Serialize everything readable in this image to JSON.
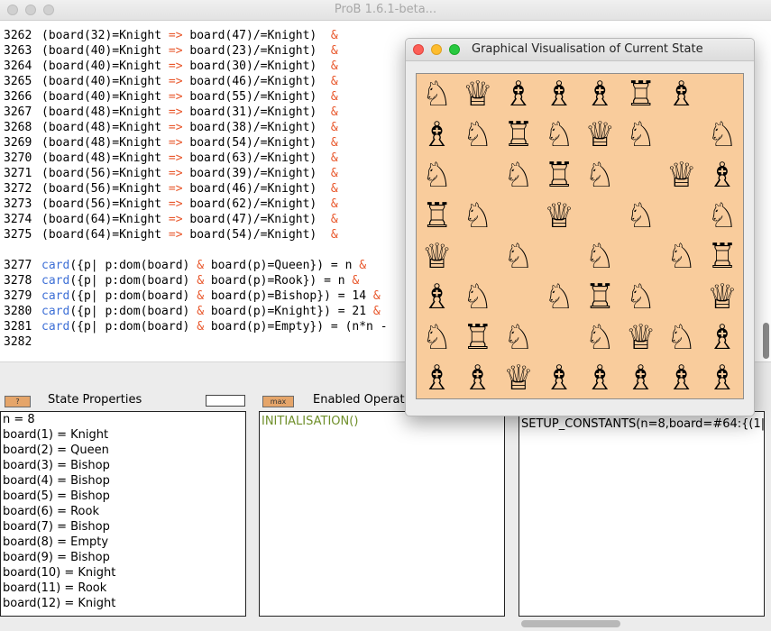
{
  "app": {
    "title": "ProB 1.6.1-beta..."
  },
  "editor": {
    "lines": [
      {
        "n": "3262",
        "a": "(board(32)=Knight ",
        "op": "=>",
        "b": " board(47)/=Knight)  ",
        "amp": "&"
      },
      {
        "n": "3263",
        "a": "(board(40)=Knight ",
        "op": "=>",
        "b": " board(23)/=Knight)  ",
        "amp": "&"
      },
      {
        "n": "3264",
        "a": "(board(40)=Knight ",
        "op": "=>",
        "b": " board(30)/=Knight)  ",
        "amp": "&"
      },
      {
        "n": "3265",
        "a": "(board(40)=Knight ",
        "op": "=>",
        "b": " board(46)/=Knight)  ",
        "amp": "&"
      },
      {
        "n": "3266",
        "a": "(board(40)=Knight ",
        "op": "=>",
        "b": " board(55)/=Knight)  ",
        "amp": "&"
      },
      {
        "n": "3267",
        "a": "(board(48)=Knight ",
        "op": "=>",
        "b": " board(31)/=Knight)  ",
        "amp": "&"
      },
      {
        "n": "3268",
        "a": "(board(48)=Knight ",
        "op": "=>",
        "b": " board(38)/=Knight)  ",
        "amp": "&"
      },
      {
        "n": "3269",
        "a": "(board(48)=Knight ",
        "op": "=>",
        "b": " board(54)/=Knight)  ",
        "amp": "&"
      },
      {
        "n": "3270",
        "a": "(board(48)=Knight ",
        "op": "=>",
        "b": " board(63)/=Knight)  ",
        "amp": "&"
      },
      {
        "n": "3271",
        "a": "(board(56)=Knight ",
        "op": "=>",
        "b": " board(39)/=Knight)  ",
        "amp": "&"
      },
      {
        "n": "3272",
        "a": "(board(56)=Knight ",
        "op": "=>",
        "b": " board(46)/=Knight)  ",
        "amp": "&"
      },
      {
        "n": "3273",
        "a": "(board(56)=Knight ",
        "op": "=>",
        "b": " board(62)/=Knight)  ",
        "amp": "&"
      },
      {
        "n": "3274",
        "a": "(board(64)=Knight ",
        "op": "=>",
        "b": " board(47)/=Knight)  ",
        "amp": "&"
      },
      {
        "n": "3275",
        "a": "(board(64)=Knight ",
        "op": "=>",
        "b": " board(54)/=Knight)  ",
        "amp": "&"
      }
    ],
    "card_lines": [
      {
        "n": "3277",
        "text": "({p| p:dom(board) ",
        "mid": "board(p)=Queen}) = n ",
        "amp": "&"
      },
      {
        "n": "3278",
        "text": "({p| p:dom(board) ",
        "mid": "board(p)=Rook}) = n ",
        "amp": "&"
      },
      {
        "n": "3279",
        "text": "({p| p:dom(board) ",
        "mid": "board(p)=Bishop}) = 14 ",
        "amp": "&"
      },
      {
        "n": "3280",
        "text": "({p| p:dom(board) ",
        "mid": "board(p)=Knight}) = 21 ",
        "amp": "&"
      },
      {
        "n": "3281",
        "text": "({p| p:dom(board) ",
        "mid": "board(p)=Empty}) = (n*n - ",
        "amp": ""
      }
    ],
    "card_kw": "card",
    "and_op": "&",
    "last_line": "3282"
  },
  "state_panel": {
    "button_label": "?",
    "title": "State Properties",
    "items": [
      "n = 8",
      "board(1) = Knight",
      "board(2) = Queen",
      "board(3) = Bishop",
      "board(4) = Bishop",
      "board(5) = Bishop",
      "board(6) = Rook",
      "board(7) = Bishop",
      "board(8) = Empty",
      "board(9) = Bishop",
      "board(10) = Knight",
      "board(11) = Rook",
      "board(12) = Knight"
    ]
  },
  "ops_panel": {
    "button_label": "max",
    "title": "Enabled Operati",
    "items": [
      "INITIALISATION()"
    ],
    "color": "#6f8f2a"
  },
  "history_panel": {
    "items": [
      "SETUP_CONSTANTS(n=8,board=#64:{(1|"
    ]
  },
  "vis_window": {
    "title": "Graphical Visualisation of Current State",
    "board_color": "#f9cc9c",
    "pieces": {
      "K": {
        "glyph": "♘",
        "name": "knight"
      },
      "Q": {
        "glyph": "♕",
        "name": "queen"
      },
      "B": {
        "glyph": "♗",
        "name": "bishop"
      },
      "R": {
        "glyph": "♖",
        "name": "rook"
      }
    },
    "grid": [
      [
        "K",
        "Q",
        "B",
        "B",
        "B",
        "R",
        "B",
        ""
      ],
      [
        "B",
        "K",
        "R",
        "K",
        "Q",
        "K",
        "",
        "K"
      ],
      [
        "K",
        "",
        "K",
        "R",
        "K",
        "",
        "Q",
        "B"
      ],
      [
        "R",
        "K",
        "",
        "Q",
        "",
        "K",
        "",
        "K"
      ],
      [
        "Q",
        "",
        "K",
        "",
        "K",
        "",
        "K",
        "R"
      ],
      [
        "B",
        "K",
        "",
        "K",
        "R",
        "K",
        "",
        "Q"
      ],
      [
        "K",
        "R",
        "K",
        "",
        "K",
        "Q",
        "K",
        "B"
      ],
      [
        "B",
        "B",
        "Q",
        "B",
        "B",
        "B",
        "B",
        "B"
      ]
    ]
  }
}
